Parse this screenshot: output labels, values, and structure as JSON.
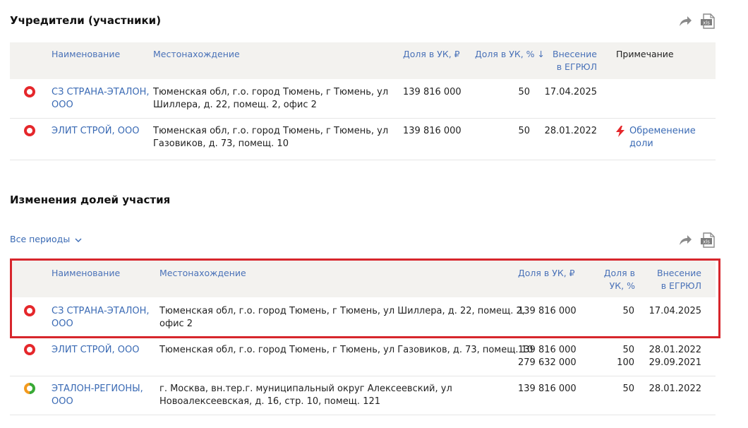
{
  "founders": {
    "title": "Учредители (участники)",
    "headers": {
      "name": "Наименование",
      "location": "Местонахождение",
      "share_rub": "Доля в УК, ₽",
      "share_pct": "Доля в УК, % ↓",
      "egrul_1": "Внесение",
      "egrul_2": "в ЕГРЮЛ",
      "note": "Примечание"
    },
    "rows": [
      {
        "name_1": "СЗ СТРАНА-ЭТАЛОН,",
        "name_2": "ООО",
        "loc_1": "Тюменская обл, г.о. город Тюмень, г Тюмень, ул",
        "loc_2": "Шиллера, д. 22, помещ. 2, офис 2",
        "share_rub": "139 816 000",
        "share_pct": "50",
        "date": "17.04.2025"
      },
      {
        "name_1": "ЭЛИТ СТРОЙ, ООО",
        "loc_1": "Тюменская обл, г.о. город Тюмень, г Тюмень, ул",
        "loc_2": "Газовиков, д. 73, помещ. 10",
        "share_rub": "139 816 000",
        "share_pct": "50",
        "date": "28.01.2022",
        "note_1": "Обременение",
        "note_2": "доли"
      }
    ]
  },
  "changes": {
    "title": "Изменения долей участия",
    "period": "Все периоды",
    "headers": {
      "name": "Наименование",
      "location": "Местонахождение",
      "share_rub": "Доля в УК, ₽",
      "share_pct_1": "Доля в",
      "share_pct_2": "УК, %",
      "egrul_1": "Внесение",
      "egrul_2": "в ЕГРЮЛ"
    },
    "rows": [
      {
        "name_1": "СЗ СТРАНА-ЭТАЛОН,",
        "name_2": "ООО",
        "loc_1": "Тюменская обл, г.о. город Тюмень, г Тюмень, ул Шиллера, д. 22, помещ. 2,",
        "loc_2": "офис 2",
        "share_rub": "139 816 000",
        "share_pct": "50",
        "date": "17.04.2025"
      },
      {
        "name_1": "ЭЛИТ СТРОЙ, ООО",
        "loc_1": "Тюменская обл, г.о. город Тюмень, г Тюмень, ул Газовиков, д. 73, помещ. 10",
        "share_rub_1": "139 816 000",
        "share_rub_2": "279 632 000",
        "share_pct_1": "50",
        "share_pct_2": "100",
        "date_1": "28.01.2022",
        "date_2": "29.09.2021"
      },
      {
        "name_1": "ЭТАЛОН-РЕГИОНЫ,",
        "name_2": "ООО",
        "loc_1": "г. Москва, вн.тер.г. муниципальный округ Алексеевский, ул",
        "loc_2": "Новоалексеевская, д. 16, стр. 10, помещ. 121",
        "share_rub": "139 816 000",
        "share_pct": "50",
        "date": "28.01.2022"
      }
    ]
  },
  "colors": {
    "link": "#3a6ab4",
    "status_red": "#e5272b",
    "highlight": "#d7262c",
    "header_bg": "#f3f2ef"
  },
  "icons": [
    "share-icon",
    "xls-icon",
    "chevron-down-icon",
    "lightning-icon",
    "status-icon"
  ]
}
